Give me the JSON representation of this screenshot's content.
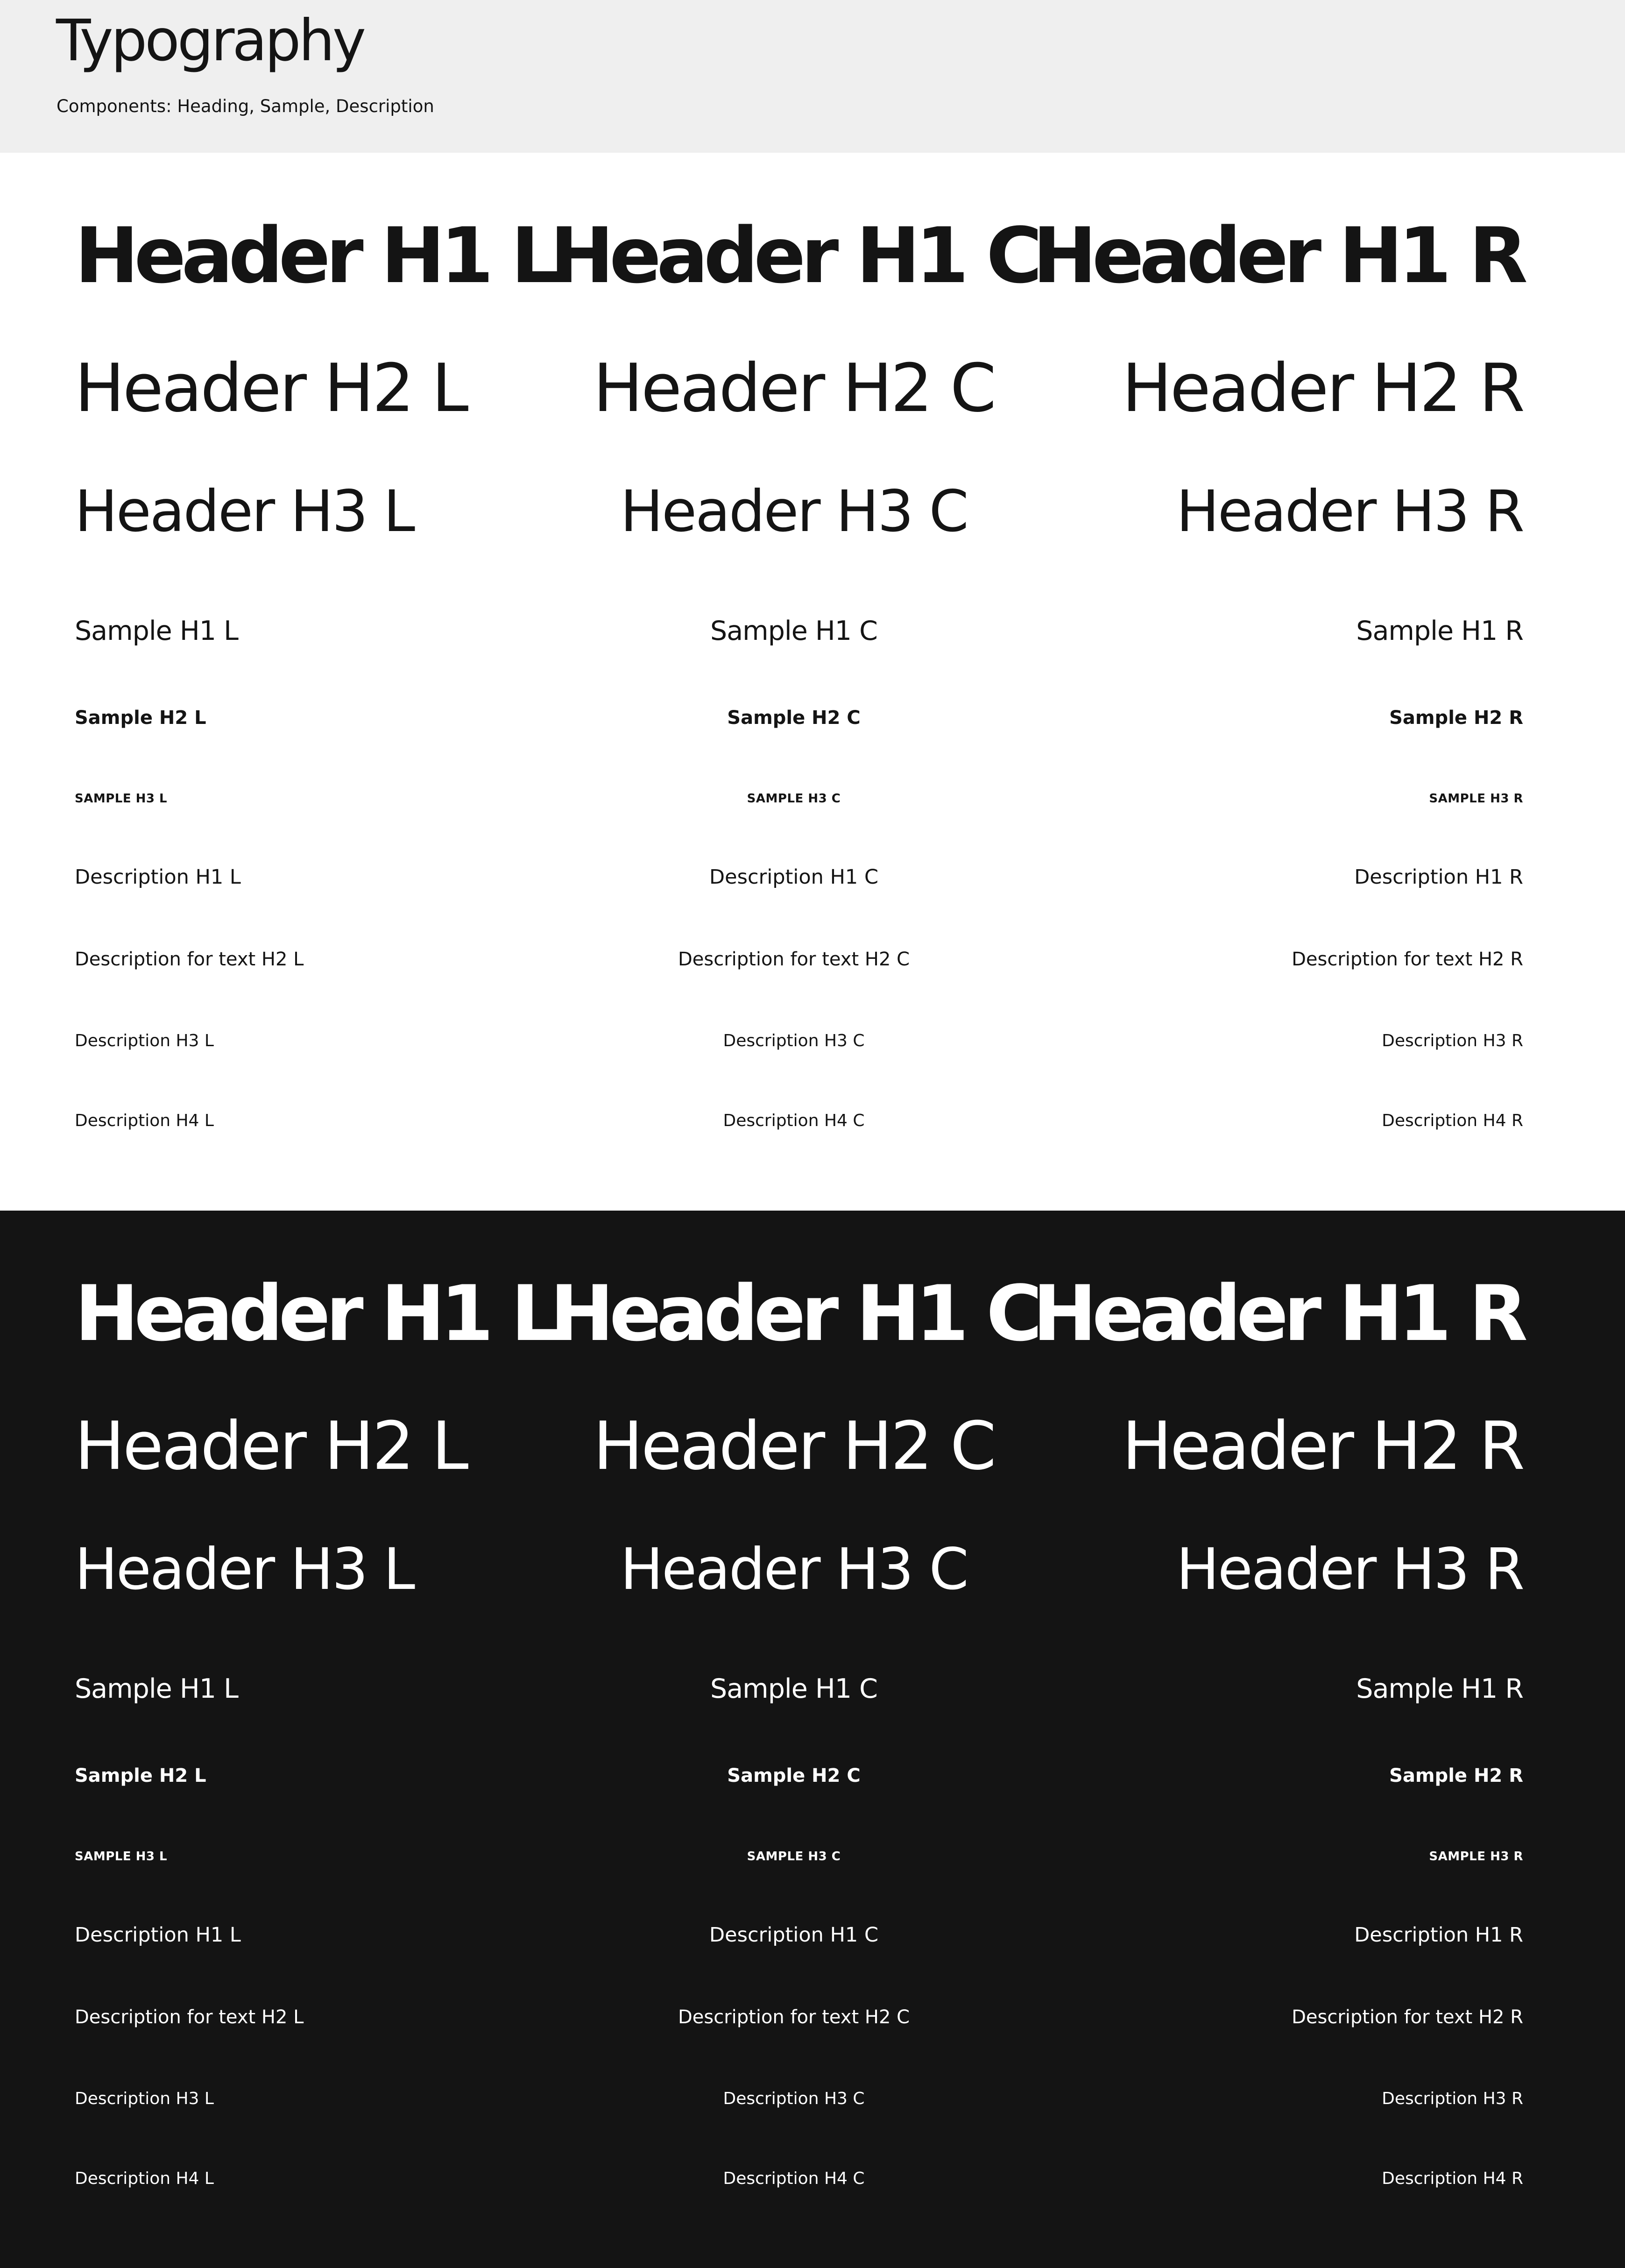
{
  "header": {
    "title": "Typography",
    "subtitle": "Components: Heading, Sample, Description"
  },
  "rows": {
    "h1": {
      "left": "Header H1 L",
      "center": "Header H1 C",
      "right": "Header H1 R"
    },
    "h2": {
      "left": "Header H2 L",
      "center": "Header H2 C",
      "right": "Header H2 R"
    },
    "h3": {
      "left": "Header H3 L",
      "center": "Header H3 C",
      "right": "Header H3 R"
    },
    "s1": {
      "left": "Sample H1 L",
      "center": "Sample H1 C",
      "right": "Sample H1 R"
    },
    "s2": {
      "left": "Sample H2 L",
      "center": "Sample H2 C",
      "right": "Sample H2 R"
    },
    "s3": {
      "left": "SAMPLE H3 L",
      "center": "SAMPLE H3 C",
      "right": "SAMPLE H3 R"
    },
    "d1": {
      "left": "Description H1 L",
      "center": "Description H1 C",
      "right": "Description H1 R"
    },
    "d2": {
      "left": "Description for text H2 L",
      "center": "Description for text H2 C",
      "right": "Description for text H2 R"
    },
    "d3": {
      "left": "Description H3 L",
      "center": "Description H3 C",
      "right": "Description H3 R"
    },
    "d4": {
      "left": "Description H4 L",
      "center": "Description H4 C",
      "right": "Description H4 R"
    }
  },
  "colors": {
    "header_band": "#efefef",
    "light_bg": "#ffffff",
    "dark_bg": "#141414",
    "ink": "#141414",
    "inverse_ink": "#ffffff"
  }
}
